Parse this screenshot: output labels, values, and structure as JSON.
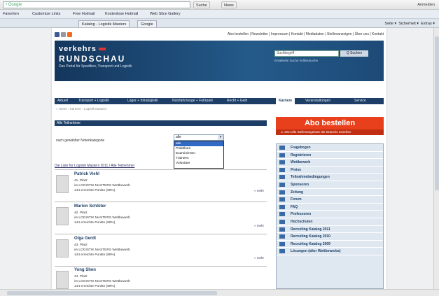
{
  "browser": {
    "search_value": "• Google",
    "search_button": "Suche",
    "news_button": "News",
    "chrome_right": "Anmelden",
    "favorites_label": "Favoriten",
    "favorites": [
      "Customize Links",
      "Free Hotmail",
      "Kostenlose Hotmail",
      "Web Slice Gallery"
    ],
    "tabs": [
      "Katalog - Logistik Masters",
      "Google"
    ],
    "tools": [
      "Seite ▾",
      "Sicherheit ▾",
      "Extras ▾"
    ]
  },
  "site": {
    "toplinks": "Abo bestellen | Newsletter | Impressum | Kontakt | Mediadaten | Stellenanzeigen | Über uns | Kontakt",
    "logo_line1": "verkehrs",
    "logo_line2": "RUNDSCHAU",
    "tagline": "Das Portal für Spedition, Transport und Logistik",
    "search_placeholder": "Suchbegriff",
    "search_button": "Q Suchen",
    "search_links": "Erweiterte Suche   Volltextsuche",
    "nav": [
      "Aktuell",
      "Transport + Logistik",
      "Lager + Intralogistik",
      "Nutzfahrzeuge + Fuhrpark",
      "Recht + Geld",
      "Karriere",
      "Veranstaltungen",
      "Service"
    ],
    "breadcrumb": "» Home › Karriere › Logistik Masters"
  },
  "ranking": {
    "box_title": "Alle Teilnehmer",
    "disc_label": "nach gewählter Notenkategorie",
    "dropdown_value": "alle",
    "dropdown_options": [
      "alle",
      "Praktikum",
      "Examinierten",
      "Trainees",
      "Volontäre"
    ],
    "list_link": "Die Liste für Logistik Masters 2011 / Alle Teilnehmer",
    "entries": [
      {
        "name": "Patrick Viehl",
        "place": "41. Platz",
        "event": "im LOGISTIK MASTERS Wettbewerb",
        "points": "144 erreichte Punkte (89%)",
        "more": "» mehr"
      },
      {
        "name": "Marion Schlüter",
        "place": "42. Platz",
        "event": "im LOGISTIK MASTERS Wettbewerb",
        "points": "144 erreichte Punkte (89%)",
        "more": "» mehr"
      },
      {
        "name": "Olga Gerdt",
        "place": "43. Platz",
        "event": "im LOGISTIK MASTERS Wettbewerb",
        "points": "144 erreichte Punkte (89%)",
        "more": "» mehr"
      },
      {
        "name": "Yong Shen",
        "place": "44. Platz",
        "event": "im LOGISTIK MASTERS Wettbewerb",
        "points": "144 erreichte Punkte (89%)",
        "more": "» mehr"
      }
    ]
  },
  "sidebar": {
    "abo_title": "Abo bestellen",
    "abo_sub": "▸ Jetzt alle Stellenangebote der Branche ansehen",
    "menu": [
      "Fragebogen",
      "Registrieren",
      "Wettbewerb",
      "Preise",
      "Teilnahmebedingungen",
      "Sponsoren",
      "Zeitung",
      "Forum",
      "FAQ",
      "Professoren",
      "Hochschulen",
      "Recruiting Katalog 2011",
      "Recruiting Katalog 2010",
      "Recruiting Katalog 2009",
      "Lösungen (alter Wettbewerbs)"
    ]
  },
  "colors": {
    "navy": "#1d3e66",
    "accent_orange": "#e8401c"
  }
}
